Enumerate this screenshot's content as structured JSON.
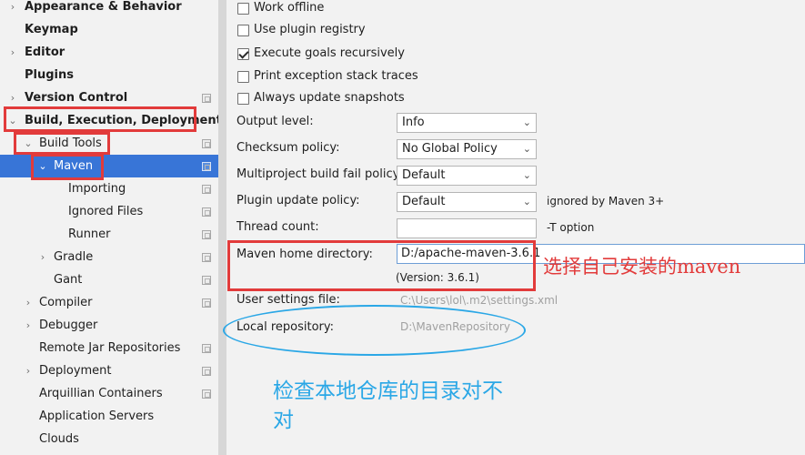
{
  "sidebar": {
    "items": [
      {
        "label": "Appearance & Behavior",
        "bold": true,
        "arrow": "›"
      },
      {
        "label": "Keymap",
        "bold": true
      },
      {
        "label": "Editor",
        "bold": true,
        "arrow": "›"
      },
      {
        "label": "Plugins",
        "bold": true
      },
      {
        "label": "Version Control",
        "bold": true,
        "arrow": "›",
        "icon": "project-icon"
      },
      {
        "label": "Build, Execution, Deployment",
        "bold": true,
        "arrow": "⌄"
      },
      {
        "label": "Build Tools",
        "arrow": "⌄",
        "icon": "project-icon"
      },
      {
        "label": "Maven",
        "arrow": "⌄",
        "icon": "project-icon",
        "selected": true
      },
      {
        "label": "Importing",
        "icon": "project-icon"
      },
      {
        "label": "Ignored Files",
        "icon": "project-icon"
      },
      {
        "label": "Runner",
        "icon": "project-icon"
      },
      {
        "label": "Gradle",
        "arrow": "›",
        "icon": "project-icon"
      },
      {
        "label": "Gant",
        "icon": "project-icon"
      },
      {
        "label": "Compiler",
        "arrow": "›",
        "icon": "project-icon"
      },
      {
        "label": "Debugger",
        "arrow": "›"
      },
      {
        "label": "Remote Jar Repositories",
        "icon": "project-icon"
      },
      {
        "label": "Deployment",
        "arrow": "›",
        "icon": "project-icon"
      },
      {
        "label": "Arquillian Containers",
        "icon": "project-icon"
      },
      {
        "label": "Application Servers"
      },
      {
        "label": "Clouds"
      }
    ]
  },
  "options": {
    "work_offline": {
      "label": "Work offline",
      "checked": false
    },
    "use_plugin_registry": {
      "label": "Use plugin registry",
      "checked": false
    },
    "execute_goals_recursively": {
      "label": "Execute goals recursively",
      "checked": true
    },
    "print_exception_stack_traces": {
      "label": "Print exception stack traces",
      "checked": false
    },
    "always_update_snapshots": {
      "label": "Always update snapshots",
      "checked": false
    }
  },
  "fields": {
    "output_level": {
      "label": "Output level:",
      "value": "Info"
    },
    "checksum_policy": {
      "label": "Checksum policy:",
      "value": "No Global Policy"
    },
    "multiproject_fail_policy": {
      "label": "Multiproject build fail policy:",
      "value": "Default"
    },
    "plugin_update_policy": {
      "label": "Plugin update policy:",
      "value": "Default",
      "hint": "ignored by Maven 3+"
    },
    "thread_count": {
      "label": "Thread count:",
      "value": "",
      "hint": "-T option"
    },
    "maven_home": {
      "label": "Maven home directory:",
      "value": "D:/apache-maven-3.6.1",
      "version": "(Version: 3.6.1)"
    },
    "user_settings": {
      "label": "User settings file:",
      "value": "C:\\Users\\lol\\.m2\\settings.xml"
    },
    "local_repository": {
      "label": "Local repository:",
      "value": "D:\\MavenRepository"
    }
  },
  "annotations": {
    "red_note": "选择自己安装的maven",
    "blue_note": "检查本地仓库的目录对不对"
  },
  "colors": {
    "selection": "#3875d7",
    "annotation_red": "#e23b3b",
    "annotation_blue": "#2aa7e6"
  }
}
